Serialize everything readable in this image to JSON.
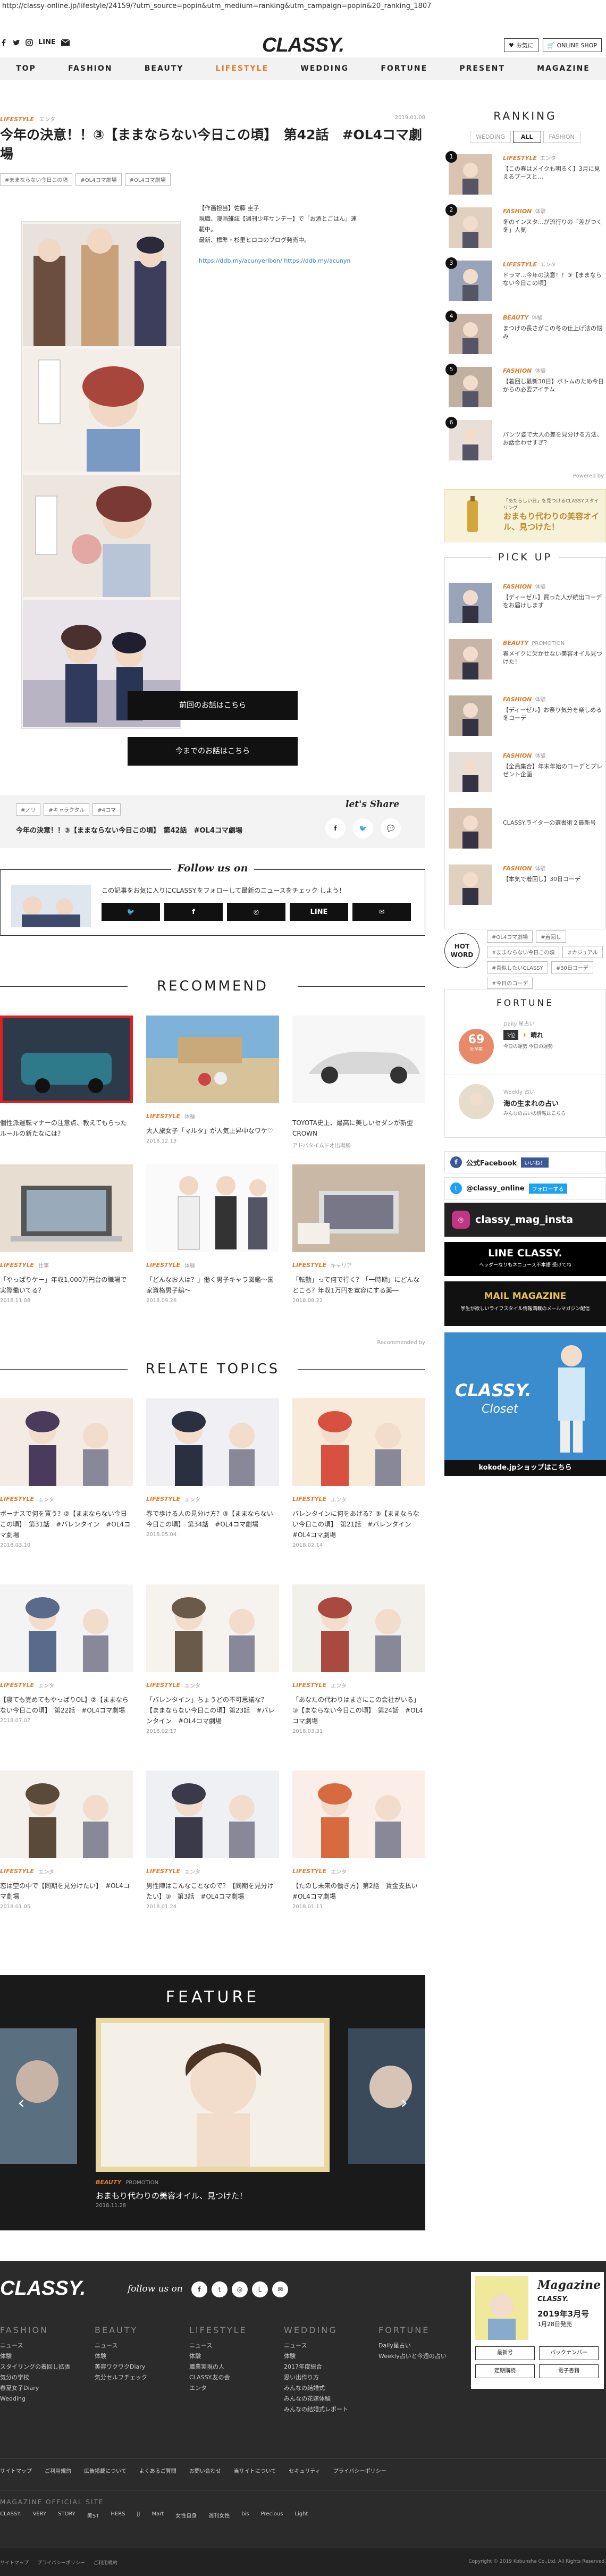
{
  "url": "http://classy-online.jp/lifestyle/24159/?utm_source=popin&utm_medium=ranking&utm_campaign=popin&20_ranking_1807",
  "header": {
    "logo": "CLASSY.",
    "line": "LINE",
    "btn_fav": "お気に",
    "btn_shop": "ONLINE SHOP"
  },
  "nav": [
    "TOP",
    "FASHION",
    "BEAUTY",
    "LIFESTYLE",
    "WEDDING",
    "FORTUNE",
    "PRESENT",
    "MAGAZINE"
  ],
  "article": {
    "category": "LIFESTYLE",
    "sub": "エンタ",
    "date": "2019.01.08",
    "title": "今年の決意！！③【ままならない今日この頃】　第42話　#OL4コマ劇場",
    "tags": [
      "#ままならない今日この頃",
      "#OL4コマ劇場",
      "#OL4コマ劇場"
    ],
    "author": "【作画担当】佐藤 圭子\n現職、漫画雑誌【週刊少年サンデー】で「お酒とごはん」連\n載中。\n最新、標準・杉里ヒロコのブログ発売中。",
    "author_link": "https://ddb.my/acunyerlbon/ https://ddb.my/acunyn",
    "btn_prev": "前回のお話はこちら",
    "btn_all": "今までのお話はこちら",
    "share_tags": [
      "#ノリ",
      "#キャラクタル",
      "#4コマ"
    ],
    "share_title": "今年の決意！！③【ままならない今日この頃】　第42話　#OL4コマ劇場",
    "lets_share": "let's Share",
    "follow_title": "Follow us on",
    "follow_desc": "この記事をお気に入りにCLASSY.をフォローして最新のニュースをチェック しよう！",
    "follow_line": "LINE"
  },
  "recommend": {
    "title": "RECOMMEND",
    "items": [
      {
        "cat": "",
        "sub": "",
        "title": "個性派運転マナーの注意点、教えてもらったルールの新たなには？",
        "date": ""
      },
      {
        "cat": "LIFESTYLE",
        "sub": "体験",
        "title": "大人旅女子「マルタ」が人気上昇中なワケ♡",
        "date": "2018.12.13"
      },
      {
        "cat": "",
        "sub": "",
        "title": "TOYOTA史上、最高に美しいセダンが新型CROWN",
        "date": "アドバタイムドオ出場勝"
      },
      {
        "cat": "LIFESTYLE",
        "sub": "仕事",
        "title": "「やっぱりケー」年収1,000万円台の職場で実際働いてる？",
        "date": "2018.11.08"
      },
      {
        "cat": "LIFESTYLE",
        "sub": "体験",
        "title": "「どんなお人は？」働く男子キャラ図鑑～国家資格男子編～",
        "date": "2018.09.26"
      },
      {
        "cat": "LIFESTYLE",
        "sub": "キャリア",
        "title": "「転勤」って何で行く？「一時期」にどんなところ？年収1万円を寛容にする薬―",
        "date": "2018.08.22"
      }
    ],
    "note": "Recommended by"
  },
  "relate": {
    "title": "RELATE TOPICS",
    "items": [
      {
        "cat": "LIFESTYLE",
        "sub": "エンタ",
        "title": "ボーナスで何を買う？②【ままならない今日この頃】　第31話　#バレンタイン　#OL4コマ劇場",
        "date": "2018.03.10"
      },
      {
        "cat": "LIFESTYLE",
        "sub": "エンタ",
        "title": "春で歩ける人の見分け方？③【ままならない今日この頃】　第34話　#OL4コマ劇場",
        "date": "2018.05.04"
      },
      {
        "cat": "LIFESTYLE",
        "sub": "エンタ",
        "title": "バレンタインに何をあげる？③【ままならない今日この頃】　第21話　#バレンタイン　#OL4コマ劇場",
        "date": "2018.02.14"
      },
      {
        "cat": "LIFESTYLE",
        "sub": "エンタ",
        "title": "【寝ても覚めてもやっぱりOL】②【ままならない今日この頃】　第22話　#OL4コマ劇場",
        "date": "2018.07.07"
      },
      {
        "cat": "LIFESTYLE",
        "sub": "エンタ",
        "title": "「バレンタイン」ちょうどの不可思議な？【ままならない今日この頃】第23話　#バレンタイン　#OL4コマ劇場",
        "date": "2018.02.17"
      },
      {
        "cat": "LIFESTYLE",
        "sub": "エンタ",
        "title": "「あなたの代わりはまさにこの会社がいる」③【まならない今日この頃】　第24話　#OL4コマ劇場",
        "date": "2018.03.31"
      },
      {
        "cat": "LIFESTYLE",
        "sub": "エンタ",
        "title": "恋は空の中で【同期を見分けたい】　#OL4コマ劇場",
        "date": "2018.01.05"
      },
      {
        "cat": "LIFESTYLE",
        "sub": "エンタ",
        "title": "男性陣はこんなことなので？【同期を見分けたい】③　第3話　#OL4コマ劇場",
        "date": "2018.01.24"
      },
      {
        "cat": "LIFESTYLE",
        "sub": "エンタ",
        "title": "【たのし未来の働き方】第2話　賃金支払い　#OL4コマ劇場",
        "date": "2018.01.11"
      }
    ]
  },
  "feature": {
    "title": "FEATURE",
    "cat": "BEAUTY",
    "sub": "PROMOTION",
    "caption": "おまもり代わりの美容オイル、見つけた！",
    "date": "2018.11.28"
  },
  "side": {
    "ranking_title": "RANKING",
    "tabs": [
      "WEDDING",
      "ALL",
      "FASHION"
    ],
    "ranking": [
      {
        "n": "1",
        "cat": "LIFESTYLE",
        "sub": "エンタ",
        "t": "【この春はメイクも明るく】3月に見えるブースと…"
      },
      {
        "n": "2",
        "cat": "FASHION",
        "sub": "体験",
        "t": "冬のインスタ…が流行りの「差がつく冬」人気"
      },
      {
        "n": "3",
        "cat": "LIFESTYLE",
        "sub": "エンタ",
        "t": "ドラマ…今年の決意！！③【ままならない今日この頃】"
      },
      {
        "n": "4",
        "cat": "BEAUTY",
        "sub": "体験",
        "t": "まつげの長さがこの冬の仕上げ法の悩み"
      },
      {
        "n": "5",
        "cat": "FASHION",
        "sub": "体験",
        "t": "【着回し最新30日】ボトムのため今日からの必要アイテム"
      },
      {
        "n": "6",
        "cat": "",
        "sub": "",
        "t": "パンツ姿で大人の差を見分ける方法、お話合わせすぎ？"
      }
    ],
    "powered": "Powered by",
    "ad_title": "おまもり代わりの美容オイル、見つけた！",
    "ad_top": "「あたらしい日」を見つけるCLASSY.スタイリング",
    "pickup_title": "PICK UP",
    "pickup": [
      {
        "cat": "FASHION",
        "sub": "体験",
        "t": "【ディーゼル】買った人が続出コーデをお届けします"
      },
      {
        "cat": "BEAUTY",
        "sub": "PROMOTION",
        "t": "春メイクに欠かせない美容オイル見つけた！"
      },
      {
        "cat": "FASHION",
        "sub": "体験",
        "t": "【ディーゼル】お祭り気分を楽しめる冬コーデ"
      },
      {
        "cat": "FASHION",
        "sub": "体験",
        "t": "【全員集合】年末年始のコーデとプレゼント企画"
      },
      {
        "cat": "",
        "sub": "",
        "t": "CLASSY.ライターの選書術２最新号"
      },
      {
        "cat": "FASHION",
        "sub": "体験",
        "t": "【本気で着回し】30日コーデ"
      }
    ],
    "hot_word": "HOT WORD",
    "hot_tags": [
      "#OL4コマ劇場",
      "#着回し",
      "#ままならない今日この頃",
      "#カジュアル",
      "#真似したいCLASSY",
      "#30日コーデ",
      "#今日のコーデ"
    ],
    "fortune_title": "FORTUNE",
    "daily": "Daily 星占い",
    "daily_score": "69",
    "daily_rank": "3位",
    "daily_label": "牡羊座",
    "daily_weather": "晴れ",
    "daily_sub": "今日の運勢 今日の運勢",
    "weekly": "Weekly 占い",
    "weekly_title": "海の生まれの占い",
    "weekly_sub": "みんなの占いの情報はこちら",
    "facebook": "公式Facebook",
    "facebook_btn": "いいね！",
    "twitter": "@classy_online",
    "twitter_btn": "フォローする",
    "instagram": "classy_mag_insta",
    "line_title": "LINE CLASSY.",
    "line_sub": "ヘッダーなりもネニュース不本語 受けてね",
    "mail_title": "MAIL MAGAZINE",
    "mail_sub": "学生が欲しいライフスタイル情報満載のメールマガジン配信",
    "closet_title": "CLASSY.",
    "closet_sub": "Closet",
    "kokode": "kokode.jpショップはこちら"
  },
  "footer": {
    "logo": "CLASSY.",
    "follow": "follow us on",
    "cols": [
      {
        "h": "FASHION",
        "items": [
          "ニュース",
          "体験",
          "スタイリングの着回し拡張",
          "気分の学校",
          "春夏女子Diary",
          "Wedding"
        ]
      },
      {
        "h": "BEAUTY",
        "items": [
          "ニュース",
          "体験",
          "美容ワクワクDiary",
          "気分セルフチェック"
        ]
      },
      {
        "h": "LIFESTYLE",
        "items": [
          "ニュース",
          "体験",
          "職業実現の人",
          "CLASSY.友の会",
          "エンタ"
        ]
      },
      {
        "h": "WEDDING",
        "items": [
          "ニュース",
          "体験",
          "2017年度総合",
          "思い出作り方",
          "みんなの結婚式",
          "みんなの花嫁体験",
          "みんなの結婚式レポート"
        ]
      },
      {
        "h": "FORTUNE",
        "items": [
          "Daily星占い",
          "Weekly占いと今週の占い"
        ]
      }
    ],
    "mag_title": "Magazine",
    "mag_sub": "CLASSY.",
    "mag_issue": "2019年3月号",
    "mag_date": "1月28日発売",
    "mag_btns": [
      "最新号",
      "バックナンバー",
      "定期購読",
      "電子書籍"
    ],
    "links": [
      "サイトマップ",
      "ご利用規約",
      "広告掲載について",
      "よくあるご質問",
      "お問い合わせ",
      "当サイトについて",
      "セキュリティ",
      "プライバシーポリシー"
    ],
    "official": "MAGAZINE OFFICIAL SITE",
    "magazines": [
      "CLASSY.",
      "VERY",
      "STORY",
      "美ST",
      "HERS",
      "JJ",
      "Mart",
      "女性自身",
      "週刊女性",
      "bis",
      "Precious",
      "Light"
    ],
    "bottom": [
      "サイトマップ",
      "プライバシーポリシー",
      "ご利用規約"
    ],
    "copyright": "Copyright © 2019 Kobunsha Co.,Ltd. All Rights Reserved."
  }
}
